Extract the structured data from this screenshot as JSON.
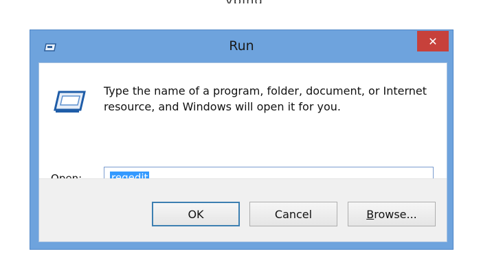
{
  "background_fragment": "yping",
  "window": {
    "title": "Run",
    "close_glyph": "✕",
    "icons": {
      "title": "run-icon",
      "dialog": "run-icon",
      "close": "close-icon",
      "dropdown": "chevron-down-icon"
    }
  },
  "dialog": {
    "message_line1": "Type the name of a program, folder, document, or Internet",
    "message_line2": "resource, and Windows will open it for you.",
    "open_label_mnemonic": "O",
    "open_label_rest": "pen:",
    "input_value": "regedit"
  },
  "buttons": {
    "ok": "OK",
    "cancel": "Cancel",
    "browse_mnemonic": "B",
    "browse_rest": "rowse..."
  },
  "colors": {
    "frame": "#6ea3dd",
    "close": "#c7413b",
    "selection": "#3399ff"
  }
}
